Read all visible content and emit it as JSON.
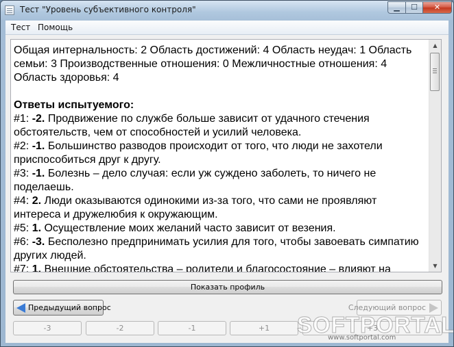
{
  "window": {
    "title": "Тест \"Уровень субъективного контроля\""
  },
  "menu": {
    "items": [
      "Тест",
      "Помощь"
    ]
  },
  "textarea": {
    "lines": [
      "Общая интернальность: 2 Область достижений: 4 Область неудач: 1 Область",
      "семьи: 3 Производственные отношения: 0 Межличностные отношения: 4",
      "Область здоровья: 4"
    ],
    "heading": "Ответы испытуемого:",
    "answers": [
      {
        "num": "#1: ",
        "score": "-2.",
        "lines": [
          "Продвижение по службе больше зависит от удачного стечения",
          "обстоятельств, чем от способностей и усилий человека."
        ]
      },
      {
        "num": "#2: ",
        "score": "-1.",
        "lines": [
          "Большинство разводов происходит от того, что люди не захотели",
          "приспособиться друг к другу."
        ]
      },
      {
        "num": "#3: ",
        "score": "-1.",
        "lines": [
          "Болезнь – дело случая: если уж суждено заболеть, то ничего не",
          "поделаешь."
        ]
      },
      {
        "num": "#4: ",
        "score": "2.",
        "lines": [
          "Люди оказываются одинокими из-за того, что сами не проявляют",
          "интереса и дружелюбия к окружающим."
        ]
      },
      {
        "num": "#5: ",
        "score": "1.",
        "lines": [
          "Осуществление моих желаний часто зависит от везения."
        ]
      },
      {
        "num": "#6: ",
        "score": "-3.",
        "lines": [
          "Бесполезно предпринимать усилия для того, чтобы завоевать симпатию",
          "других людей."
        ]
      },
      {
        "num": "#7: ",
        "score": "1.",
        "lines": [
          "Внешние обстоятельства – родители и благосостояние – влияют на"
        ]
      }
    ]
  },
  "buttons": {
    "profile": "Показать профиль",
    "prev": "Предыдущий вопрос",
    "next": "Следующий вопрос",
    "scores": [
      "-3",
      "-2",
      "-1",
      "+1",
      "+3"
    ]
  },
  "watermark": {
    "logo": "SOFTPORTAL",
    "url": "www.softportal.com"
  },
  "icons": {
    "window_controls": [
      "minimize-icon",
      "maximize-icon",
      "close-icon"
    ],
    "prev": "arrow-left-icon",
    "next": "arrow-right-icon"
  }
}
